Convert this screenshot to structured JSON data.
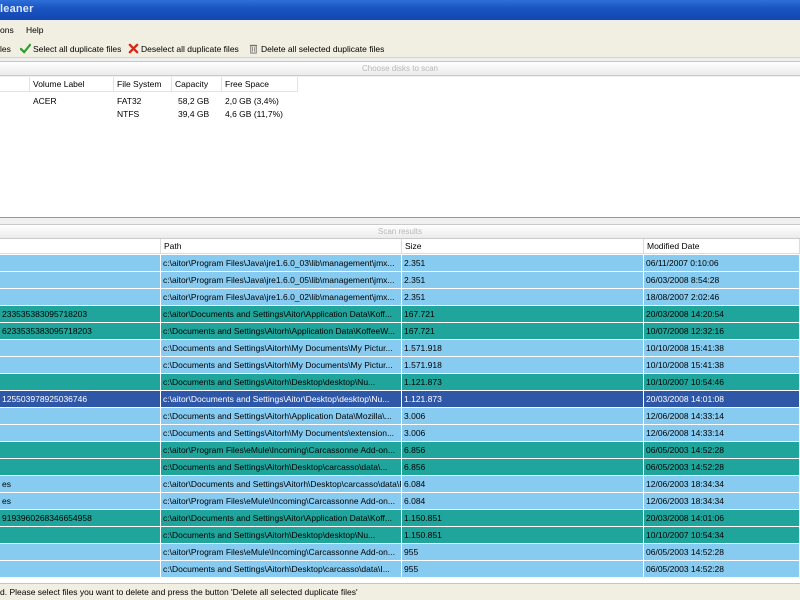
{
  "window": {
    "title": "leaner"
  },
  "menu": {
    "items": [
      "ons",
      "Help"
    ]
  },
  "toolbar": {
    "items": [
      {
        "label": "les"
      },
      {
        "label": "Select all duplicate files"
      },
      {
        "label": "Deselect all duplicate files"
      },
      {
        "label": "Delete all selected duplicate files"
      }
    ]
  },
  "disks": {
    "header": "Choose disks to scan",
    "columns": [
      "Volume Label",
      "File System",
      "Capacity",
      "Free Space"
    ],
    "rows": [
      {
        "label": "ACER",
        "fs": "FAT32",
        "capacity": "58,2 GB",
        "free": "2,0 GB (3,4%)"
      },
      {
        "label": "",
        "fs": "NTFS",
        "capacity": "39,4 GB",
        "free": "4,6 GB (11,7%)"
      }
    ]
  },
  "results": {
    "header": "Scan results",
    "columns": [
      "Path",
      "Size",
      "Modified Date"
    ],
    "rows": [
      {
        "name": "",
        "path": "c:\\aitor\\Program Files\\Java\\jre1.6.0_03\\lib\\management\\jmx...",
        "size": "2.351",
        "date": "06/11/2007 0:10:06",
        "style": "light"
      },
      {
        "name": "",
        "path": "c:\\aitor\\Program Files\\Java\\jre1.6.0_05\\lib\\management\\jmx...",
        "size": "2.351",
        "date": "06/03/2008 8:54:28",
        "style": "light"
      },
      {
        "name": "",
        "path": "c:\\aitor\\Program Files\\Java\\jre1.6.0_02\\lib\\management\\jmx...",
        "size": "2.351",
        "date": "18/08/2007 2:02:46",
        "style": "light"
      },
      {
        "name": "233535383095718203",
        "path": "c:\\aitor\\Documents and Settings\\Aitor\\Application Data\\Koff...",
        "size": "167.721",
        "date": "20/03/2008 14:20:54",
        "style": "teal"
      },
      {
        "name": "6233535383095718203",
        "path": "c:\\Documents and Settings\\Aitorh\\Application Data\\KoffeeW...",
        "size": "167.721",
        "date": "10/07/2008 12:32:16",
        "style": "teal"
      },
      {
        "name": "",
        "path": "c:\\Documents and Settings\\Aitorh\\My Documents\\My Pictur...",
        "size": "1.571.918",
        "date": "10/10/2008 15:41:38",
        "style": "light"
      },
      {
        "name": "",
        "path": "c:\\Documents and Settings\\Aitorh\\My Documents\\My Pictur...",
        "size": "1.571.918",
        "date": "10/10/2008 15:41:38",
        "style": "light"
      },
      {
        "name": "",
        "path": "c:\\Documents and Settings\\Aitorh\\Desktop\\desktop\\Nu...",
        "size": "1.121.873",
        "date": "10/10/2007 10:54:46",
        "style": "teal"
      },
      {
        "name": "125503978925036746",
        "path": "c:\\aitor\\Documents and Settings\\Aitor\\Desktop\\desktop\\Nu...",
        "size": "1.121.873",
        "date": "20/03/2008 14:01:08",
        "style": "sel"
      },
      {
        "name": "",
        "path": "c:\\Documents and Settings\\Aitorh\\Application Data\\Mozilla\\...",
        "size": "3.006",
        "date": "12/06/2008 14:33:14",
        "style": "light"
      },
      {
        "name": "",
        "path": "c:\\Documents and Settings\\Aitorh\\My Documents\\extension...",
        "size": "3.006",
        "date": "12/06/2008 14:33:14",
        "style": "light"
      },
      {
        "name": "",
        "path": "c:\\aitor\\Program Files\\eMule\\Incoming\\Carcassonne Add-on...",
        "size": "6.856",
        "date": "06/05/2003 14:52:28",
        "style": "teal"
      },
      {
        "name": "",
        "path": "c:\\Documents and Settings\\Aitorh\\Desktop\\carcasso\\data\\...",
        "size": "6.856",
        "date": "06/05/2003 14:52:28",
        "style": "teal"
      },
      {
        "name": "es",
        "path": "c:\\aitor\\Documents and Settings\\Aitorh\\Desktop\\carcasso\\data\\F...",
        "size": "6.084",
        "date": "12/06/2003 18:34:34",
        "style": "light"
      },
      {
        "name": "es",
        "path": "c:\\aitor\\Program Files\\eMule\\Incoming\\Carcassonne Add-on...",
        "size": "6.084",
        "date": "12/06/2003 18:34:34",
        "style": "light"
      },
      {
        "name": "919396026834665495​8",
        "path": "c:\\aitor\\Documents and Settings\\Aitor\\Application Data\\Koff...",
        "size": "1.150.851",
        "date": "20/03/2008 14:01:06",
        "style": "teal"
      },
      {
        "name": "",
        "path": "c:\\Documents and Settings\\Aitorh\\Desktop\\desktop\\Nu...",
        "size": "1.150.851",
        "date": "10/10/2007 10:54:34",
        "style": "teal"
      },
      {
        "name": "",
        "path": "c:\\aitor\\Program Files\\eMule\\Incoming\\Carcassonne Add-on...",
        "size": "955",
        "date": "06/05/2003 14:52:28",
        "style": "light"
      },
      {
        "name": "",
        "path": "c:\\Documents and Settings\\Aitorh\\Desktop\\carcasso\\data\\I...",
        "size": "955",
        "date": "06/05/2003 14:52:28",
        "style": "light"
      }
    ]
  },
  "status": {
    "text": "d. Please select files you want to delete and press the button 'Delete all selected duplicate files'"
  }
}
